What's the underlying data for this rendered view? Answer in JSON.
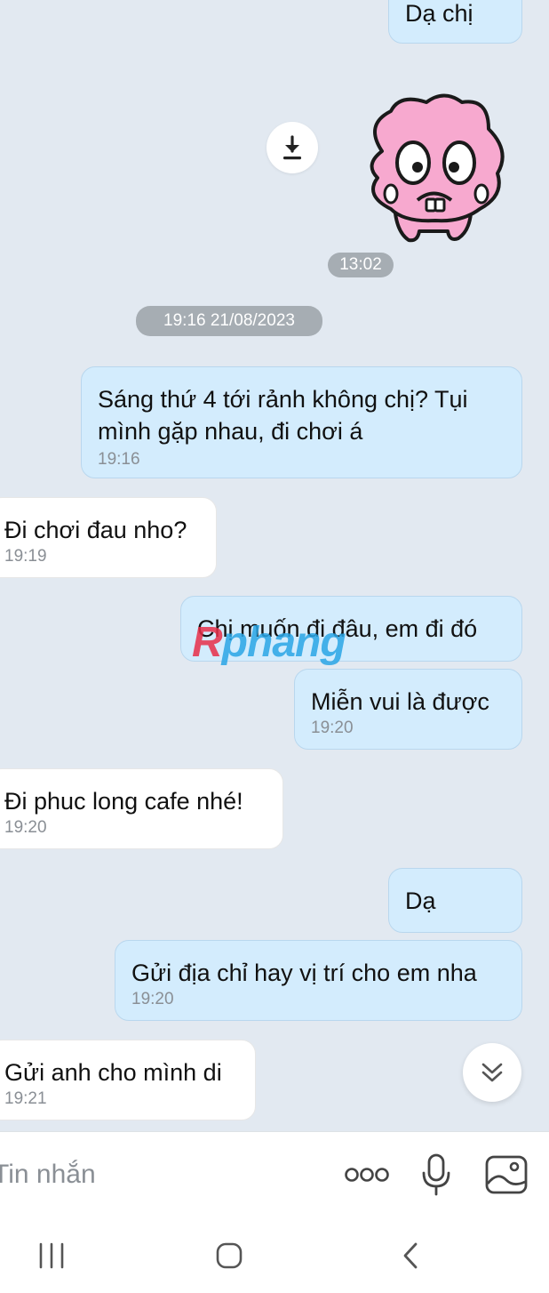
{
  "messages": [
    {
      "text": "Dạ chị"
    },
    {
      "time": "13:02"
    },
    {
      "text": "Sáng thứ 4 tới rảnh không chị? Tụi mình gặp nhau, đi chơi á",
      "time": "19:16"
    },
    {
      "text": "Đi chơi đau nho?",
      "time": "19:19"
    },
    {
      "text": "Chị muốn đi đâu, em đi đó"
    },
    {
      "text": "Miễn vui là được",
      "time": "19:20"
    },
    {
      "text": "Đi phuc long cafe nhé!",
      "time": "19:20"
    },
    {
      "text": "Dạ"
    },
    {
      "text": "Gửi địa chỉ hay vị trí cho em nha",
      "time": "19:20"
    },
    {
      "text": "Gửi anh cho mình di",
      "time": "19:21"
    }
  ],
  "date_separator": "19:16 21/08/2023",
  "watermark": {
    "part1": "R",
    "part2": "phang"
  },
  "composer": {
    "placeholder": "Tin nhắn",
    "icons": [
      "more-icon",
      "microphone-icon",
      "image-icon"
    ]
  },
  "icons": {
    "download": "download-icon",
    "scroll_down": "double-chevron-down-icon",
    "sticker": "pink-creature-sticker"
  },
  "navbar": {
    "icons": [
      "recent-apps-icon",
      "home-icon",
      "back-icon"
    ]
  },
  "colors": {
    "background": "#e2e9f1",
    "outgoing_bubble": "#d3ecfd",
    "incoming_bubble": "#ffffff",
    "time_pill": "#a6adb3",
    "sticker_pink": "#f7a9cf"
  }
}
